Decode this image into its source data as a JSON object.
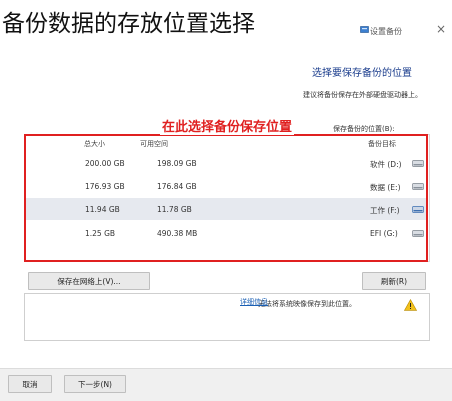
{
  "overlay_title": "备份数据的存放位置选择",
  "window": {
    "title": "设置备份",
    "close_glyph": "×"
  },
  "heading": "选择要保存备份的位置",
  "subheading": "建议将备份保存在外部硬盘驱动器上。",
  "select_label": "保存备份的位置(B):",
  "annotation": "在此选择备份保存位置",
  "table": {
    "columns": [
      "备份目标",
      "可用空间",
      "总大小"
    ],
    "rows": [
      {
        "name": "软件 (D:)",
        "free": "198.09 GB",
        "total": "200.00 GB",
        "selected": false
      },
      {
        "name": "数据 (E:)",
        "free": "176.84 GB",
        "total": "176.93 GB",
        "selected": false
      },
      {
        "name": "工作 (F:)",
        "free": "11.78 GB",
        "total": "11.94 GB",
        "selected": true
      },
      {
        "name": "EFI (G:)",
        "free": "490.38 MB",
        "total": "1.25 GB",
        "selected": false
      }
    ]
  },
  "buttons": {
    "refresh": "刷新(R)",
    "network": "保存在网络上(V)...",
    "cancel": "取消",
    "next": "下一步(N)"
  },
  "info": {
    "message": "无法将系统映像保存到此位置。",
    "link": "详细信息"
  },
  "colors": {
    "accent": "#1a3c8c",
    "annotation_red": "#e02020",
    "link": "#1a5fb4",
    "selected_row": "#e6e9ef"
  }
}
